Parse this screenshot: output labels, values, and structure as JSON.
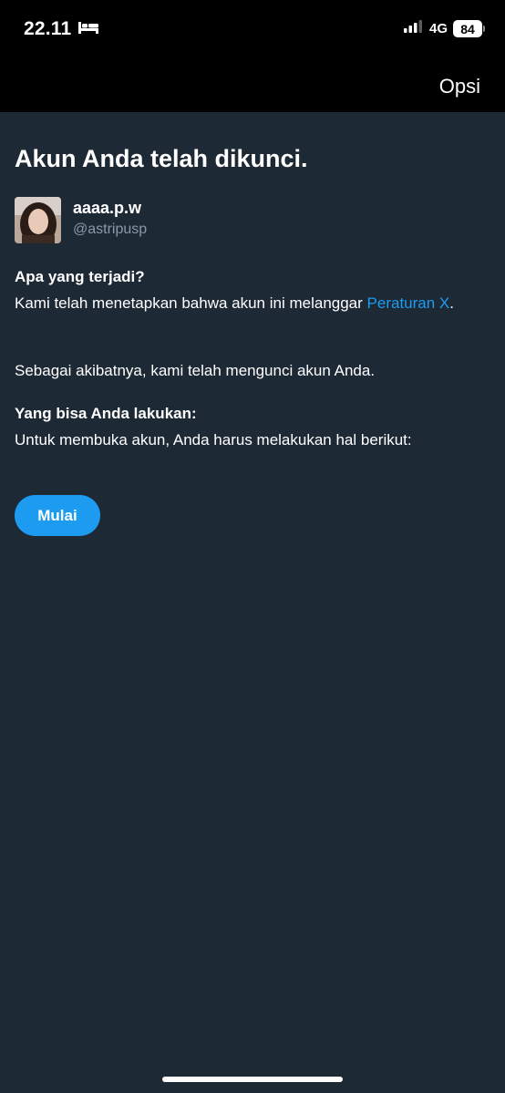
{
  "status_bar": {
    "time": "22.11",
    "network": "4G",
    "battery_level": "84"
  },
  "header": {
    "options_label": "Opsi"
  },
  "main": {
    "title": "Akun Anda telah dikunci.",
    "account": {
      "display_name": "aaaa.p.w",
      "handle": "@astripusp"
    },
    "what_happened_heading": "Apa yang terjadi?",
    "violation_text": "Kami telah menetapkan bahwa akun ini melanggar ",
    "rules_link": "Peraturan X",
    "violation_suffix": ".",
    "consequence_text": "Sebagai akibatnya, kami telah mengunci akun Anda.",
    "what_to_do_heading": "Yang bisa Anda lakukan:",
    "instructions_text": "Untuk membuka akun, Anda harus melakukan hal berikut:",
    "start_button_label": "Mulai"
  },
  "colors": {
    "background": "#1e2936",
    "top_bar": "#000000",
    "accent": "#1d9bf0",
    "secondary_text": "#8b98a5"
  }
}
